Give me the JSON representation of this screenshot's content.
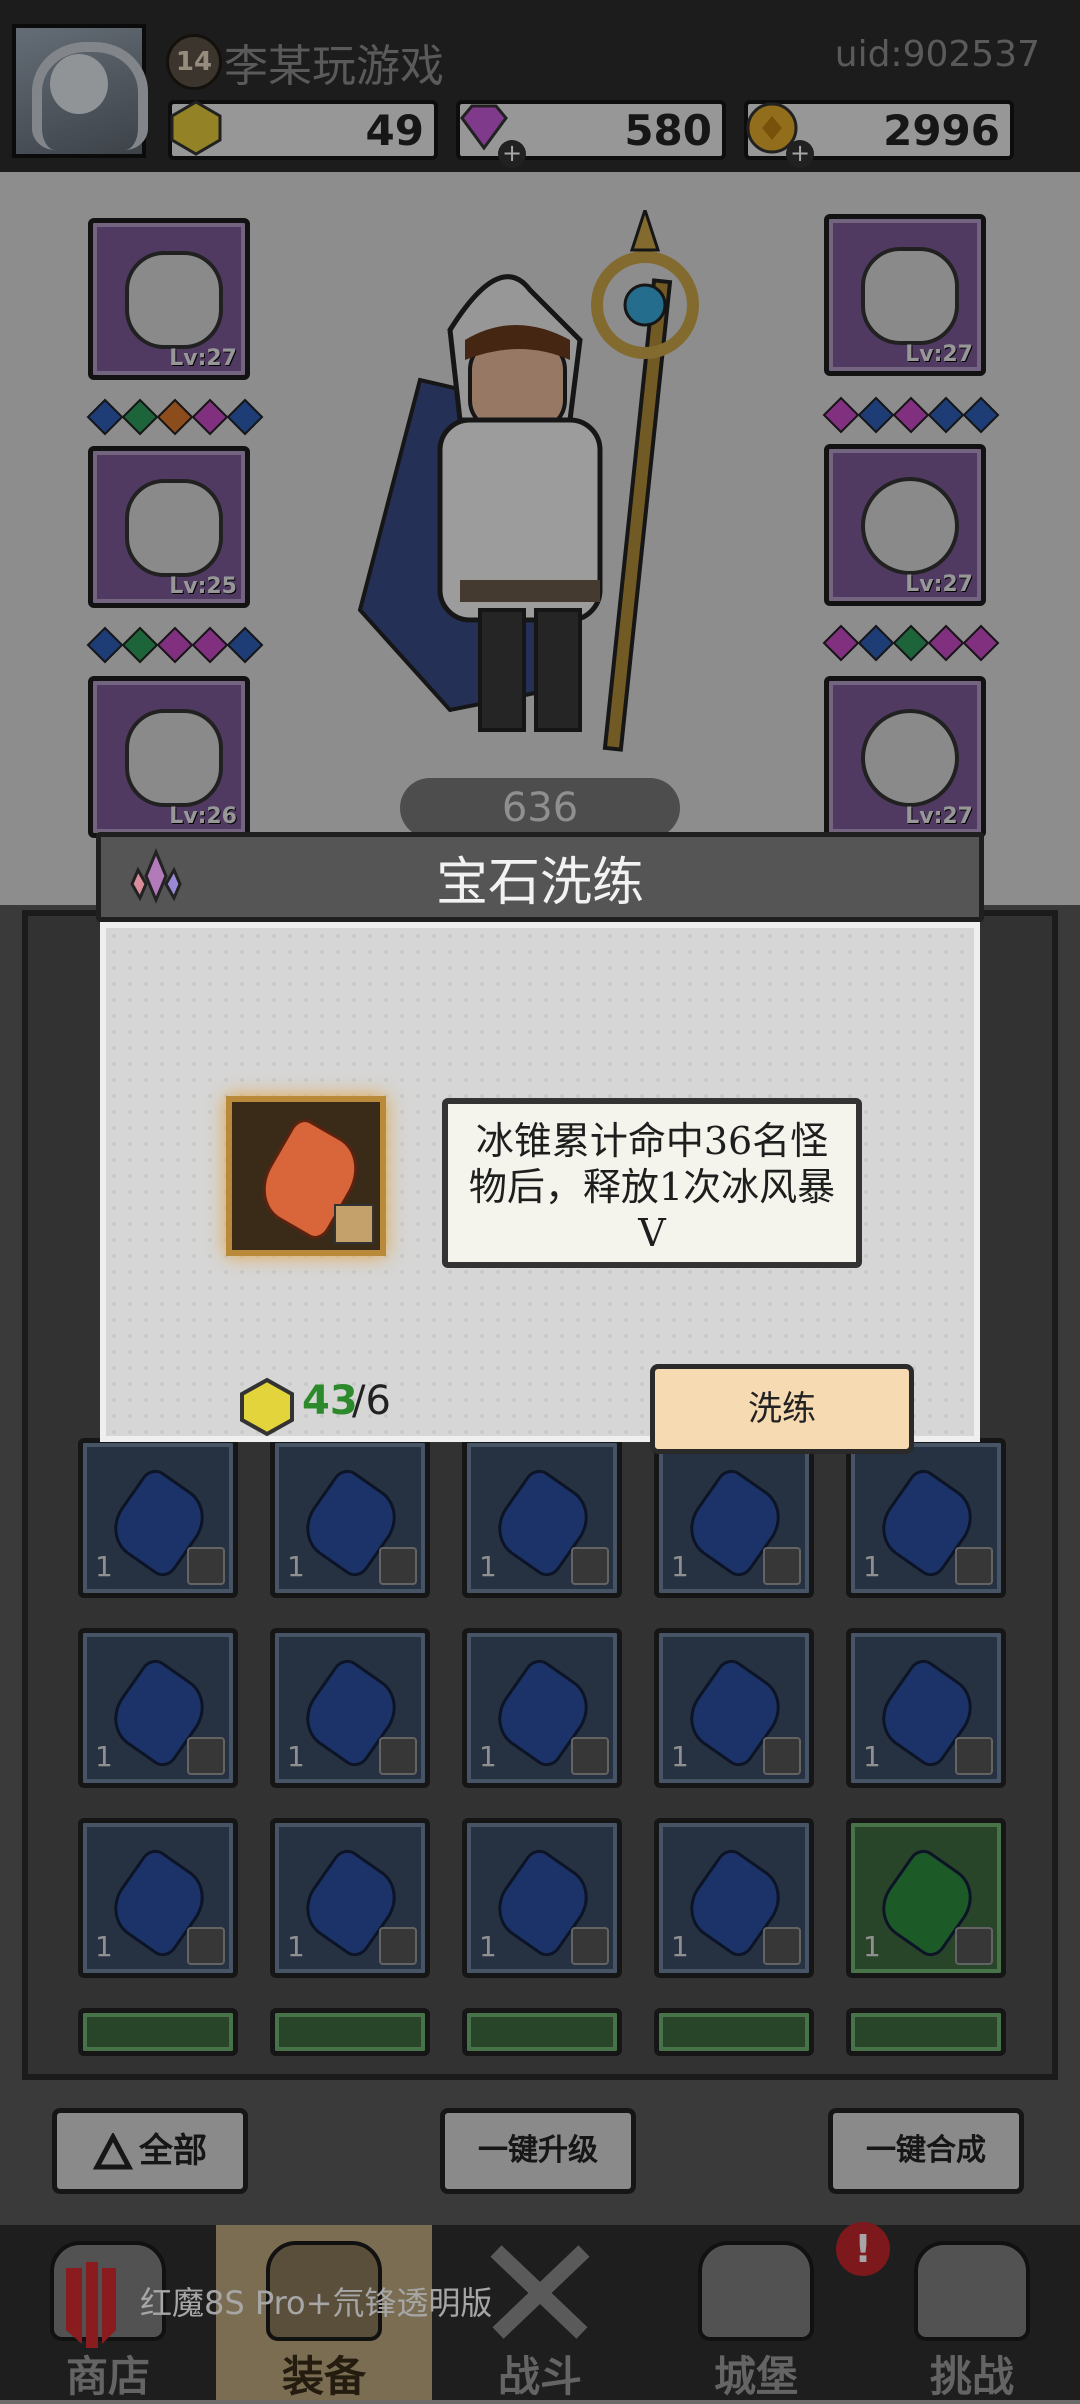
{
  "header": {
    "level": "14",
    "player_name": "李某玩游戏",
    "uid": "uid:902537",
    "currencies": [
      {
        "name": "yellow-gem",
        "value": "49",
        "color": "#e3c93b"
      },
      {
        "name": "diamond",
        "value": "580",
        "color": "#c45ad6"
      },
      {
        "name": "gold-coin",
        "value": "2996",
        "color": "#e0a82b"
      }
    ]
  },
  "equipment": {
    "left": [
      {
        "name": "hood",
        "level": "Lv:27"
      },
      {
        "name": "cloak",
        "level": "Lv:25"
      },
      {
        "name": "boots",
        "level": "Lv:26"
      }
    ],
    "right": [
      {
        "name": "shoulder",
        "level": "Lv:27"
      },
      {
        "name": "ring",
        "level": "Lv:27"
      },
      {
        "name": "necklace",
        "level": "Lv:27"
      }
    ],
    "power": "636"
  },
  "dialog": {
    "title": "宝石洗练",
    "gem_color": "#d9653a",
    "description": "冰锥累计命中36名怪物后，释放1次冰风暴V",
    "cost_owned": "43",
    "cost_required": "/6",
    "refine_button": "洗练"
  },
  "inventory": {
    "count_label": "1"
  },
  "actions": {
    "all_label": "全部",
    "upgrade_all_label": "一键升级",
    "merge_all_label": "一键合成"
  },
  "nav": {
    "items": [
      {
        "label": "商店"
      },
      {
        "label": "装备"
      },
      {
        "label": "战斗"
      },
      {
        "label": "城堡"
      },
      {
        "label": "挑战"
      }
    ],
    "badge": "!"
  },
  "watermark": "红魔8S Pro+氘锋透明版"
}
